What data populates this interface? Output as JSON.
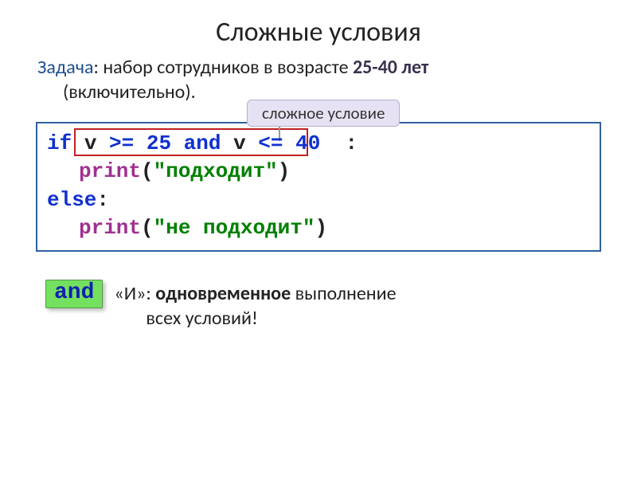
{
  "title": "Сложные условия",
  "task": {
    "label": "Задача",
    "text1": ": набор сотрудников в возрасте ",
    "age": "25-40 лет",
    "text2": "(включительно)."
  },
  "callout": "сложное условие",
  "code": {
    "kw_if": "if",
    "cond_var": " v ",
    "op1": ">=",
    "num1": " 25 ",
    "and": "and",
    "cond_var2": " v ",
    "op2": "<=",
    "num2": " 40 ",
    "colon": " :",
    "print": "print",
    "str1": "\"подходит\"",
    "kw_else": "else",
    "colon2": ":",
    "str2": "\"не подходит\""
  },
  "and_block": {
    "badge": "and",
    "quote_open": "«И»: ",
    "bold1": "одновременное",
    "rest1": " выполнение",
    "rest2": "всех условий!"
  }
}
